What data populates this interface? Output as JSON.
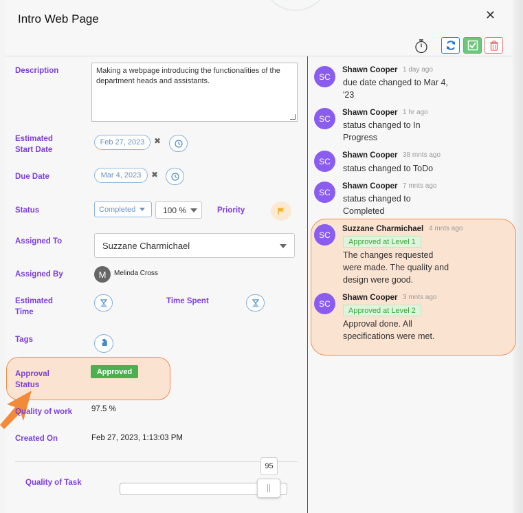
{
  "window": {
    "title": "Intro Web Page",
    "close_glyph": "✕"
  },
  "toolbar": {
    "timer_icon": "stopwatch-icon",
    "refresh_icon": "refresh-icon",
    "complete_icon": "check-icon",
    "delete_icon": "trash-icon"
  },
  "form": {
    "description": {
      "label": "Description",
      "value": "Making a webpage introducing the functionalities of the department heads and assistants."
    },
    "start_date": {
      "label_1": "Estimated",
      "label_2": "Start Date",
      "value": "Feb 27, 2023"
    },
    "due_date": {
      "label": "Due Date",
      "value": "Mar 4, 2023"
    },
    "clear_glyph": "✖",
    "status": {
      "label": "Status",
      "value": "Completed",
      "percent": "100 %"
    },
    "priority": {
      "label": "Priority"
    },
    "assigned_to": {
      "label": "Assigned To",
      "value": "Suzzane Charmichael"
    },
    "assigned_by": {
      "label": "Assigned By",
      "avatar_initial": "M",
      "name": "Melinda Cross"
    },
    "estimated_time": {
      "label_1": "Estimated",
      "label_2": "Time"
    },
    "time_spent": {
      "label": "Time Spent"
    },
    "tags": {
      "label": "Tags"
    },
    "approval_status": {
      "label_1": "Approval",
      "label_2": "Status",
      "value": "Approved"
    },
    "quality_of_work": {
      "label": "Quality of work",
      "value": "97.5 %"
    },
    "created_on": {
      "label": "Created On",
      "value": "Feb 27, 2023, 1:13:03 PM"
    },
    "quality_of_task": {
      "label": "Quality of Task",
      "value": "95",
      "level": 0.95
    }
  },
  "activity": [
    {
      "initials": "SC",
      "name": "Shawn Cooper",
      "time": "1 day ago",
      "text_lines": [
        "due date changed to Mar 4,",
        "'23"
      ]
    },
    {
      "initials": "SC",
      "name": "Shawn Cooper",
      "time": "1 hr ago",
      "text_lines": [
        "status changed to In",
        "Progress"
      ]
    },
    {
      "initials": "SC",
      "name": "Shawn Cooper",
      "time": "38 mnts ago",
      "text_lines": [
        "status changed to ToDo"
      ]
    },
    {
      "initials": "SC",
      "name": "Shawn Cooper",
      "time": "7 mnts ago",
      "text_lines": [
        "status changed to",
        "Completed"
      ]
    },
    {
      "initials": "SC",
      "name": "Suzzane Charmichael",
      "time": "4 mnts ago",
      "badge": "Approved at Level 1",
      "text_lines": [
        "The changes requested",
        "were made. The quality and",
        "design were good."
      ]
    },
    {
      "initials": "SC",
      "name": "Shawn Cooper",
      "time": "3 mnts ago",
      "badge": "Approved at Level 2",
      "text_lines": [
        "Approval done. All",
        "specifications were met."
      ]
    }
  ],
  "colors": {
    "label": "#7c3fd8",
    "avatar": "#8a5cf0",
    "highlight": "#fbe3d2",
    "highlight_border": "#f08c4b",
    "approved": "#4caf50"
  }
}
